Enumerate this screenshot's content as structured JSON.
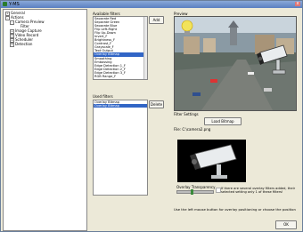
{
  "window": {
    "title": "Y-MS",
    "close_label": "x"
  },
  "tree": {
    "items": [
      {
        "label": "General",
        "expander": "+"
      },
      {
        "label": "Actions",
        "expander": "-"
      },
      {
        "label": "Camera Preview",
        "expander": "-"
      },
      {
        "label": "Filter",
        "expander": ""
      },
      {
        "label": "Image Capture",
        "expander": "+"
      },
      {
        "label": "Video Record",
        "expander": "+"
      },
      {
        "label": "Scheduler",
        "expander": "+"
      },
      {
        "label": "Detection",
        "expander": "+"
      }
    ]
  },
  "available_filters": {
    "label": "Available filters",
    "add_label": "Add",
    "items": [
      "Separate Red",
      "Separate Green",
      "Separate Blue",
      "Flip Left-Right",
      "Flip Up-Down",
      "Invert_F",
      "Brightness_F",
      "Contrast_F",
      "Grayscale_F",
      "Text Output",
      "Overlay Bitmap",
      "Smoothing",
      "Embossing",
      "Edge Detection 1_F",
      "Edge Detection 2_F",
      "Edge Detection 3_F",
      "RGB Range_F"
    ],
    "selected": "Overlay Bitmap"
  },
  "used_filters": {
    "label": "Used filters",
    "delete_label": "Delete",
    "items": [
      "Overlay Bitmap",
      "Overlay Bitmap"
    ],
    "selected": "Overlay Bitmap"
  },
  "preview": {
    "label": "Preview"
  },
  "filter_settings": {
    "label": "Filter Settings",
    "load_bitmap_label": "Load Bitmap",
    "file_text": "File: C:\\camera2.png",
    "overlay_transparency_label": "Overlay Transparency",
    "transparency_value": 0.4,
    "note": "If there are several overlay filters added, their selected setting only 1 of these filters!",
    "help_text": "Use the left mouse button for overlay positioning or choose the position"
  },
  "footer": {
    "ok_label": "OK"
  },
  "colors": {
    "selection": "#3165c6",
    "titlebar": "#5a7fc0",
    "window_bg": "#ece9d8"
  },
  "icons": [
    "app-icon",
    "close-icon",
    "lightbulb-icon",
    "security-camera-icon"
  ]
}
